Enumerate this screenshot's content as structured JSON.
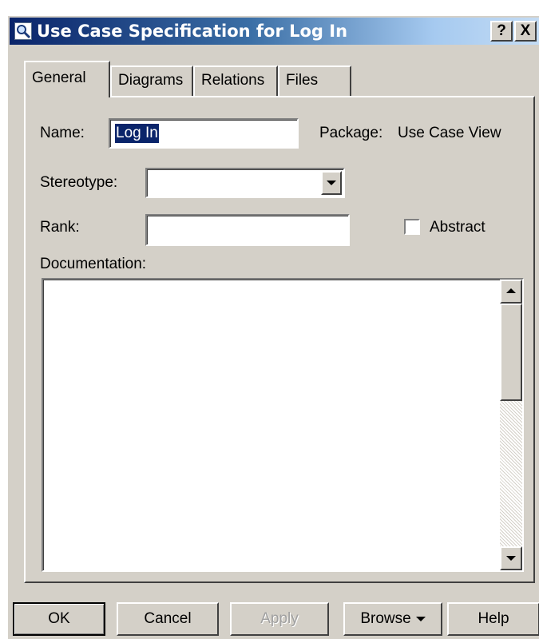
{
  "window": {
    "title": "Use Case Specification for Log In",
    "help_glyph": "?",
    "close_glyph": "X",
    "icon": "magnifier-icon"
  },
  "tabs": [
    {
      "label": "General",
      "active": true
    },
    {
      "label": "Diagrams",
      "active": false
    },
    {
      "label": "Relations",
      "active": false
    },
    {
      "label": "Files",
      "active": false
    }
  ],
  "form": {
    "name_label": "Name:",
    "name_value": "Log In",
    "package_label": "Package:",
    "package_value": "Use Case View",
    "stereotype_label": "Stereotype:",
    "stereotype_value": "",
    "rank_label": "Rank:",
    "rank_value": "",
    "abstract_label": "Abstract",
    "abstract_checked": false,
    "documentation_label": "Documentation:",
    "documentation_value": ""
  },
  "buttons": {
    "ok": "OK",
    "cancel": "Cancel",
    "apply": "Apply",
    "browse": "Browse",
    "help": "Help"
  },
  "colors": {
    "dialog_face": "#d4d0c8",
    "title_start": "#0a246a",
    "title_end": "#a6caf0",
    "selection": "#0a246a"
  }
}
